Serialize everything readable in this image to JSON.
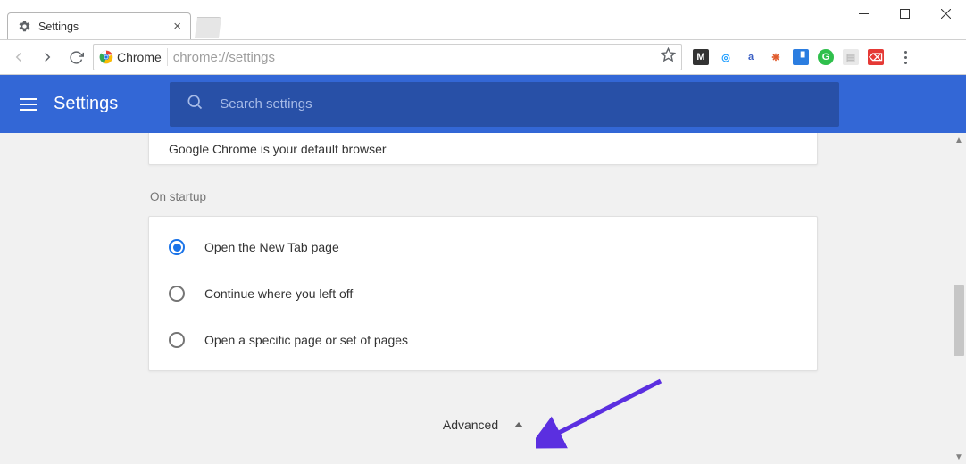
{
  "window": {
    "tab_title": "Settings"
  },
  "toolbar": {
    "secure_label": "Chrome",
    "url": "chrome://settings"
  },
  "extensions": [
    {
      "name": "ext-m",
      "bg": "#333333",
      "fg": "#ffffff",
      "label": "M"
    },
    {
      "name": "ext-o1",
      "bg": "#ffffff",
      "fg": "#1a9cff",
      "label": "◎",
      "border": "#ffffff"
    },
    {
      "name": "ext-a",
      "bg": "#ffffff",
      "fg": "#3b5fc4",
      "label": "a",
      "round": true
    },
    {
      "name": "ext-sp",
      "bg": "#ffffff",
      "fg": "#e05a2b",
      "label": "❋"
    },
    {
      "name": "ext-tb",
      "bg": "#2b7de0",
      "fg": "#ffffff",
      "label": "▝"
    },
    {
      "name": "ext-g",
      "bg": "#2fbf4c",
      "fg": "#ffffff",
      "label": "G",
      "round": true
    },
    {
      "name": "ext-pg",
      "bg": "#e9e9e9",
      "fg": "#bdbdbd",
      "label": "▤"
    },
    {
      "name": "ext-e",
      "bg": "#e53935",
      "fg": "#ffffff",
      "label": "⌫"
    }
  ],
  "header": {
    "title": "Settings",
    "search_placeholder": "Search settings"
  },
  "default_browser_card": {
    "text": "Google Chrome is your default browser"
  },
  "startup": {
    "label": "On startup",
    "options": [
      {
        "label": "Open the New Tab page",
        "checked": true
      },
      {
        "label": "Continue where you left off",
        "checked": false
      },
      {
        "label": "Open a specific page or set of pages",
        "checked": false
      }
    ]
  },
  "advanced": {
    "label": "Advanced"
  },
  "colors": {
    "header_blue": "#3367d6",
    "search_blue": "#2850a7",
    "accent": "#1a73e8",
    "arrow_annotation": "#5b2fe0"
  }
}
